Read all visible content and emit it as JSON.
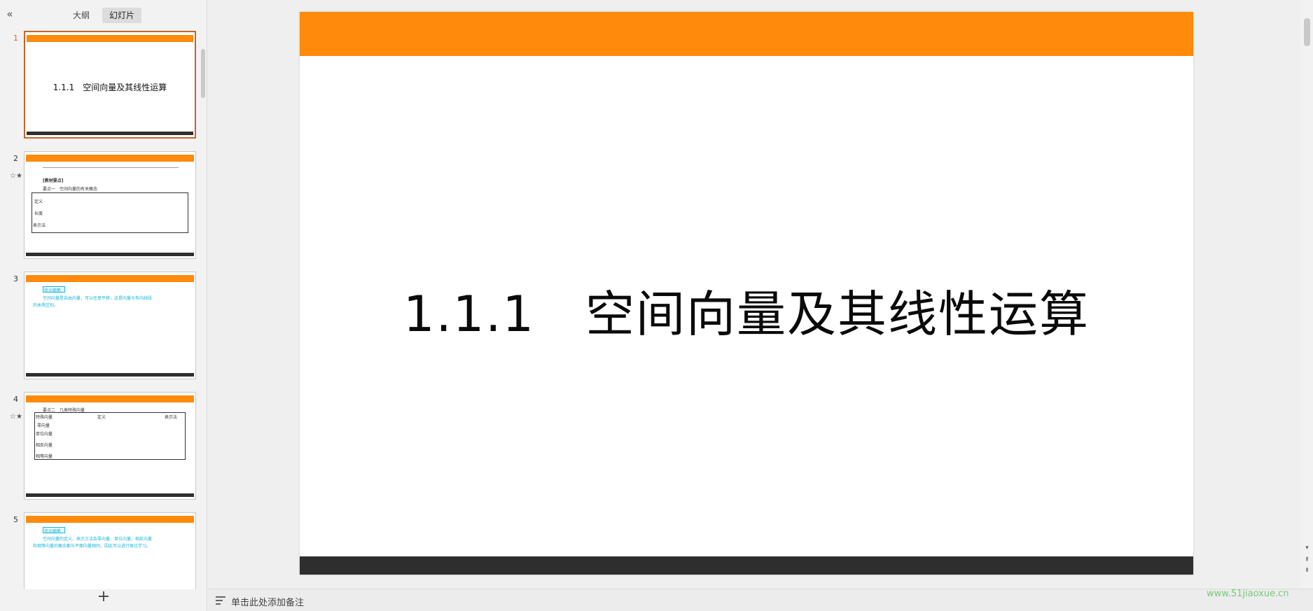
{
  "left_panel": {
    "collapse_icon": "double-chevron-left-icon",
    "tabs": [
      {
        "label": "大纲",
        "active": false
      },
      {
        "label": "幻灯片",
        "active": true
      }
    ],
    "thumbnails": [
      {
        "number": "1",
        "title": "1.1.1　空间向量及其线性运算",
        "active": true
      },
      {
        "number": "2",
        "star": "☆★",
        "heading": "[教材要点]",
        "sub": "要点一　空间向量的有关概念",
        "rows": [
          "定义",
          "长度",
          "表示法"
        ]
      },
      {
        "number": "3",
        "tag": "状元随笔",
        "text1": "空间向量是自由向量，可以任意平移，这是向量与有向线段",
        "text2": "的本质区别。"
      },
      {
        "number": "4",
        "star": "☆★",
        "sub": "要点二　几类特殊向量",
        "headers": [
          "特殊向量",
          "定义",
          "表示法"
        ],
        "rows": [
          "零向量",
          "单位向量",
          "相反向量",
          "相等向量"
        ]
      },
      {
        "number": "5",
        "tag": "状元随笔",
        "text1": "空间向量的定义、表示方法及零向量、单位向量、相反向量",
        "text2": "和相等向量的概念都与平面向量相同，因此可以进行类比学习。"
      }
    ],
    "add_label": "+"
  },
  "slide": {
    "title": "1.1.1　空间向量及其线性运算",
    "accent_color": "#ff8a0c",
    "bar_color": "#2e2e2e"
  },
  "notes": {
    "icon": "notes-list-icon",
    "placeholder": "单击此处添加备注"
  },
  "watermark": "www.51jiaoxue.cn"
}
